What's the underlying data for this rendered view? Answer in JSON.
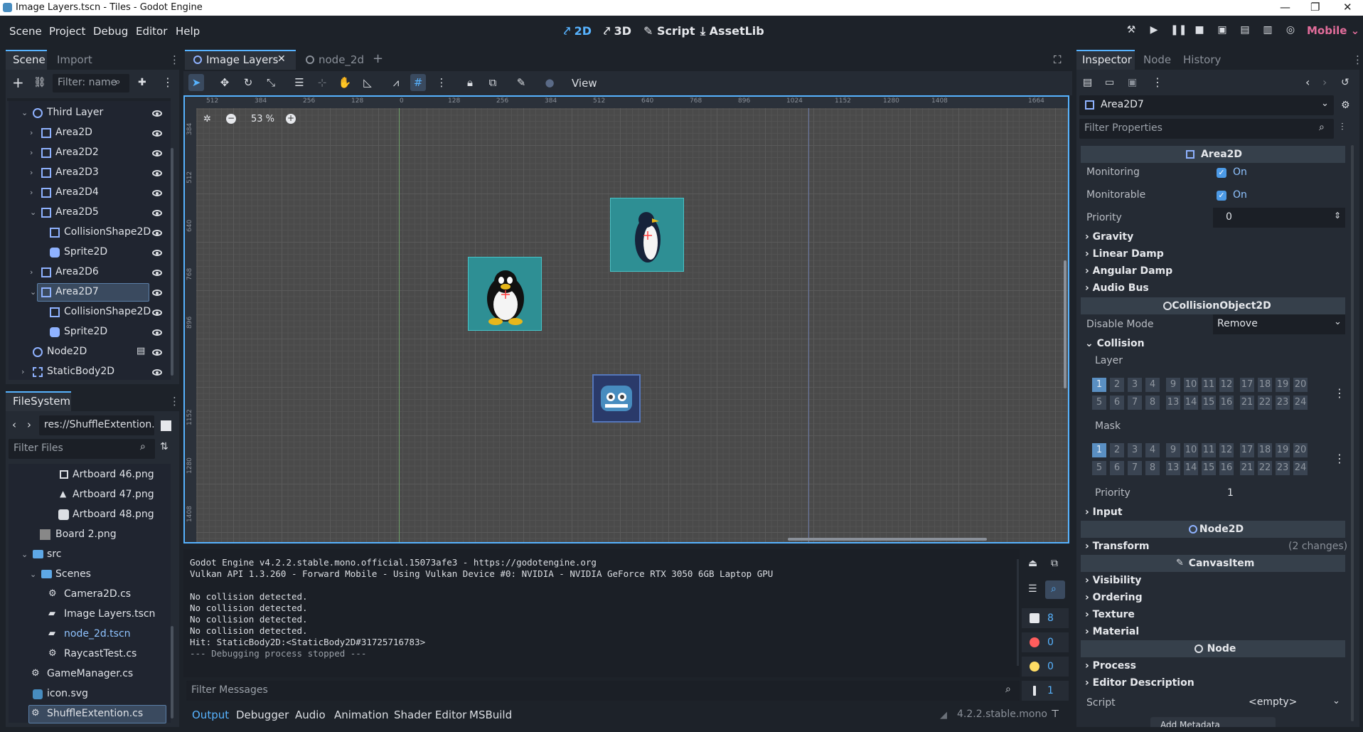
{
  "window": {
    "title": "Image Layers.tscn - Tiles - Godot Engine"
  },
  "menu": [
    "Scene",
    "Project",
    "Debug",
    "Editor",
    "Help"
  ],
  "workspaces": {
    "w2d": "2D",
    "w3d": "3D",
    "script": "Script",
    "assetlib": "AssetLib"
  },
  "renderer": "Mobile",
  "scene_dock": {
    "tabs": [
      "Scene",
      "Import"
    ],
    "filter_placeholder": "Filter: name",
    "tree": [
      {
        "label": "Third Layer",
        "icon": "node2d-icon",
        "depth": 1,
        "expanded": true
      },
      {
        "label": "Area2D",
        "icon": "area2d-icon",
        "depth": 2
      },
      {
        "label": "Area2D2",
        "icon": "area2d-icon",
        "depth": 2
      },
      {
        "label": "Area2D3",
        "icon": "area2d-icon",
        "depth": 2
      },
      {
        "label": "Area2D4",
        "icon": "area2d-icon",
        "depth": 2
      },
      {
        "label": "Area2D5",
        "icon": "area2d-icon",
        "depth": 2,
        "expanded": true
      },
      {
        "label": "CollisionShape2D",
        "icon": "collision-shape-icon",
        "depth": 3
      },
      {
        "label": "Sprite2D",
        "icon": "sprite2d-icon",
        "depth": 3
      },
      {
        "label": "Area2D6",
        "icon": "area2d-icon",
        "depth": 2
      },
      {
        "label": "Area2D7",
        "icon": "area2d-icon",
        "depth": 2,
        "expanded": true,
        "selected": true
      },
      {
        "label": "CollisionShape2D",
        "icon": "collision-shape-icon",
        "depth": 3
      },
      {
        "label": "Sprite2D",
        "icon": "sprite2d-icon",
        "depth": 3
      },
      {
        "label": "Node2D",
        "icon": "node2d-icon",
        "depth": 1,
        "script": true
      },
      {
        "label": "StaticBody2D",
        "icon": "staticbody-icon",
        "depth": 1
      }
    ]
  },
  "filesystem": {
    "title": "FileSystem",
    "path": "res://ShuffleExtention.c",
    "filter_placeholder": "Filter Files",
    "items": [
      {
        "label": "Artboard 46.png",
        "depth": 3
      },
      {
        "label": "Artboard 47.png",
        "depth": 3
      },
      {
        "label": "Artboard 48.png",
        "depth": 3
      },
      {
        "label": "Board 2.png",
        "depth": 2
      },
      {
        "label": "src",
        "depth": 1,
        "folder": true
      },
      {
        "label": "Scenes",
        "depth": 2,
        "folder": true
      },
      {
        "label": "Camera2D.cs",
        "depth": 2
      },
      {
        "label": "Image Layers.tscn",
        "depth": 2
      },
      {
        "label": "node_2d.tscn",
        "depth": 2,
        "highlight": true
      },
      {
        "label": "RaycastTest.cs",
        "depth": 2
      },
      {
        "label": "GameManager.cs",
        "depth": 1
      },
      {
        "label": "icon.svg",
        "depth": 1
      },
      {
        "label": "ShuffleExtention.cs",
        "depth": 1,
        "selected": true
      }
    ]
  },
  "editor_tabs": [
    "Image Layers",
    "node_2d"
  ],
  "viewport": {
    "zoom": "53 %",
    "view_menu": "View",
    "hruler": [
      "512",
      "384",
      "256",
      "128",
      "0",
      "128",
      "256",
      "384",
      "512",
      "640",
      "768",
      "896",
      "1024",
      "1152",
      "1280",
      "1408",
      "1664"
    ],
    "vruler": [
      "384",
      "512",
      "640",
      "768",
      "896",
      "1152",
      "1280",
      "1408"
    ]
  },
  "output": {
    "lines": [
      "Godot Engine v4.2.2.stable.mono.official.15073afe3 - https://godotengine.org",
      "Vulkan API 1.3.260 - Forward Mobile - Using Vulkan Device #0: NVIDIA - NVIDIA GeForce RTX 3050 6GB Laptop GPU",
      "",
      "No collision detected.",
      "No collision detected.",
      "No collision detected.",
      "No collision detected.",
      "Hit: StaticBody2D:<StaticBody2D#31725716783>",
      "--- Debugging process stopped ---"
    ],
    "filter_placeholder": "Filter Messages",
    "counters": {
      "messages": "8",
      "errors": "0",
      "warnings": "0",
      "info": "1"
    },
    "bottom_tabs": [
      "Output",
      "Debugger",
      "Audio",
      "Animation",
      "Shader Editor",
      "MSBuild"
    ],
    "version": "4.2.2.stable.mono"
  },
  "inspector": {
    "tabs": [
      "Inspector",
      "Node",
      "History"
    ],
    "node_name": "Area2D7",
    "filter_placeholder": "Filter Properties",
    "sections": {
      "area2d": "Area2D",
      "collisionobject": "CollisionObject2D",
      "node2d": "Node2D",
      "canvasitem": "CanvasItem",
      "node": "Node"
    },
    "props": {
      "monitoring_label": "Monitoring",
      "monitoring_value": "On",
      "monitorable_label": "Monitorable",
      "monitorable_value": "On",
      "priority_label": "Priority",
      "priority_value": "0",
      "disable_mode_label": "Disable Mode",
      "disable_mode_value": "Remove",
      "collision_group": "Collision",
      "layer_label": "Layer",
      "mask_label": "Mask",
      "coll_priority_label": "Priority",
      "coll_priority_value": "1",
      "transform_changes": "(2 changes)",
      "script_label": "Script",
      "script_value": "<empty>",
      "add_metadata": "Add Metadata"
    },
    "groups": {
      "gravity": "Gravity",
      "linear_damp": "Linear Damp",
      "angular_damp": "Angular Damp",
      "audio_bus": "Audio Bus",
      "input": "Input",
      "transform": "Transform",
      "visibility": "Visibility",
      "ordering": "Ordering",
      "texture": "Texture",
      "material": "Material",
      "process": "Process",
      "editor_description": "Editor Description"
    },
    "layer_grid": {
      "row1": [
        "1",
        "2",
        "3",
        "4",
        "9",
        "10",
        "11",
        "12",
        "17",
        "18",
        "19",
        "20"
      ],
      "row2": [
        "5",
        "6",
        "7",
        "8",
        "13",
        "14",
        "15",
        "16",
        "21",
        "22",
        "23",
        "24"
      ],
      "active": [
        "1"
      ]
    }
  }
}
